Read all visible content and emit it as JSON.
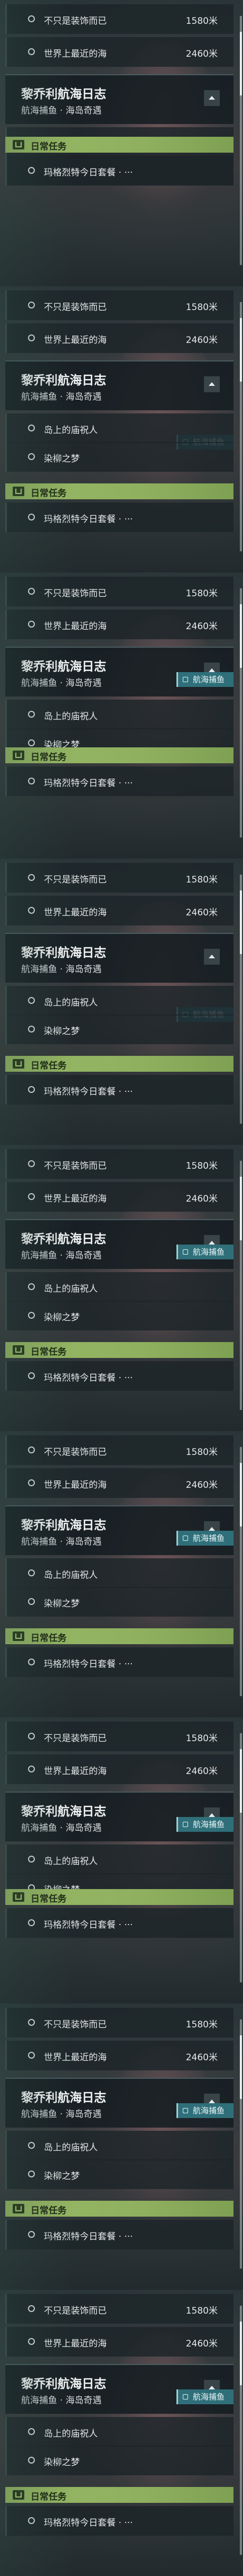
{
  "quest": {
    "title": "黎乔利航海日志",
    "subtitle": "航海捕鱼 · 海岛奇遇",
    "tag": "航海捕鱼",
    "objectives": [
      {
        "label": "不只是装饰而已",
        "distance": "1580米"
      },
      {
        "label": "世界上最近的海",
        "distance": "2460米"
      }
    ],
    "sub_objectives": [
      {
        "label": "岛上的庙祝人"
      },
      {
        "label": "染柳之梦"
      }
    ]
  },
  "daily": {
    "label": "日常任务",
    "item": "玛格烈特今日套餐 · ···"
  }
}
